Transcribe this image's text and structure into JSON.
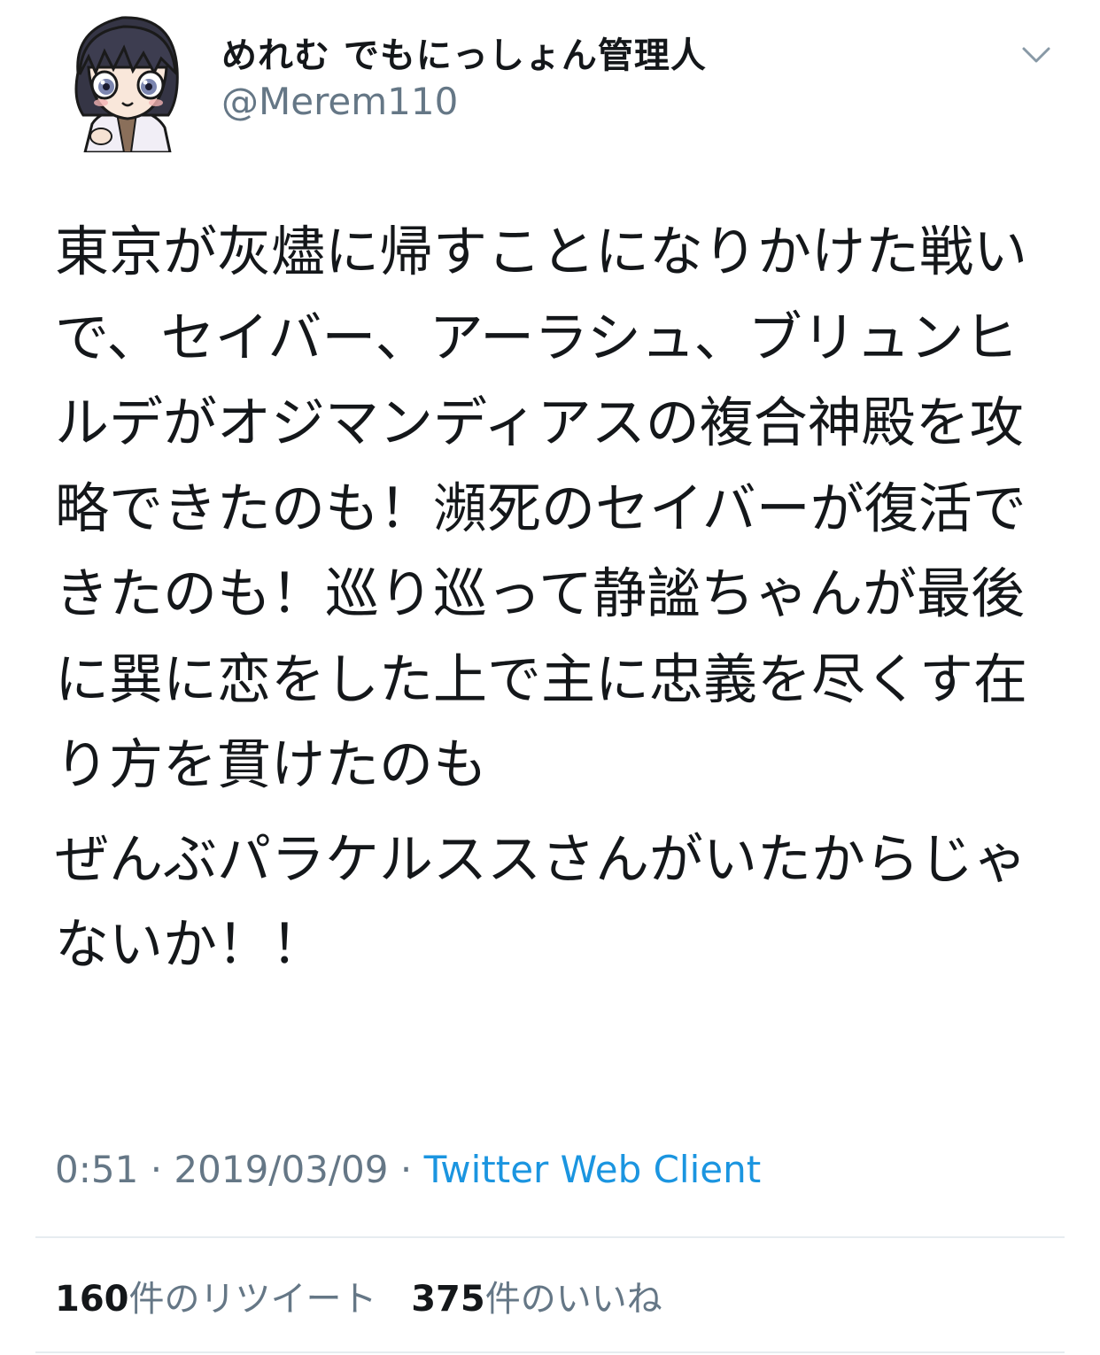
{
  "user": {
    "display_name": "めれむ でもにっしょん管理人",
    "handle": "@Merem110",
    "avatar_icon": "anime-avatar-icon"
  },
  "menu": {
    "icon": "chevron-down-icon"
  },
  "tweet": {
    "paragraphs": [
      "東京が灰燼に帰すことになりかけた戦いで、セイバー、アーラシュ、ブリュンヒルデがオジマンディアスの複合神殿を攻略できたのも！瀕死のセイバーが復活できたのも！巡り巡って静謐ちゃんが最後に巽に恋をした上で主に忠義を尽くす在り方を貫けたのも",
      "ぜんぶパラケルススさんがいたからじゃないか！！"
    ],
    "time": "0:51",
    "separator": "·",
    "date": "2019/03/09",
    "source": "Twitter Web Client"
  },
  "stats": {
    "retweets_count": "160",
    "retweets_label": "件のリツイート",
    "likes_count": "375",
    "likes_label": "件のいいね"
  },
  "colors": {
    "text": "#14171a",
    "secondary": "#657786",
    "link": "#1b95e0",
    "divider": "#e6ecf0"
  }
}
